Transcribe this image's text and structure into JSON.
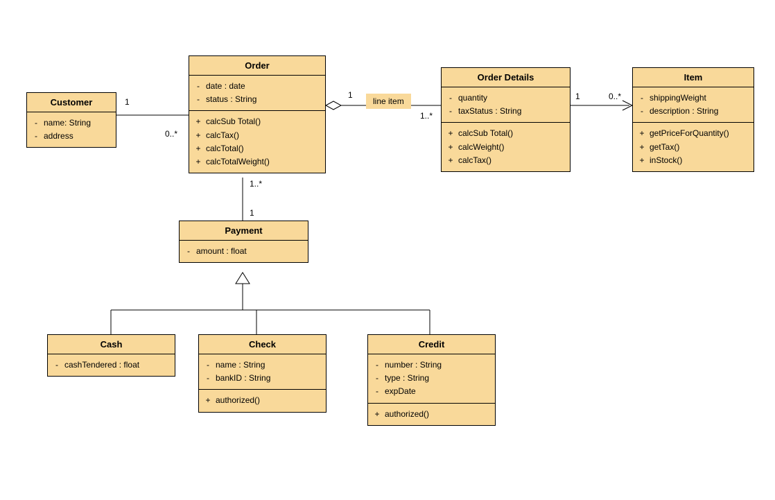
{
  "classes": {
    "customer": {
      "name": "Customer",
      "attrs": [
        {
          "vis": "-",
          "txt": "name: String"
        },
        {
          "vis": "-",
          "txt": "address"
        }
      ]
    },
    "order": {
      "name": "Order",
      "attrs": [
        {
          "vis": "-",
          "txt": "date : date"
        },
        {
          "vis": "-",
          "txt": "status : String"
        }
      ],
      "ops": [
        {
          "vis": "+",
          "txt": "calcSub Total()"
        },
        {
          "vis": "+",
          "txt": "calcTax()"
        },
        {
          "vis": "+",
          "txt": "calcTotal()"
        },
        {
          "vis": "+",
          "txt": "calcTotalWeight()"
        }
      ]
    },
    "orderDetails": {
      "name": "Order Details",
      "attrs": [
        {
          "vis": "-",
          "txt": "quantity"
        },
        {
          "vis": "-",
          "txt": "taxStatus : String"
        }
      ],
      "ops": [
        {
          "vis": "+",
          "txt": "calcSub Total()"
        },
        {
          "vis": "+",
          "txt": "calcWeight()"
        },
        {
          "vis": "+",
          "txt": "calcTax()"
        }
      ]
    },
    "item": {
      "name": "Item",
      "attrs": [
        {
          "vis": "-",
          "txt": "shippingWeight"
        },
        {
          "vis": "-",
          "txt": "description : String"
        }
      ],
      "ops": [
        {
          "vis": "+",
          "txt": "getPriceForQuantity()"
        },
        {
          "vis": "+",
          "txt": "getTax()"
        },
        {
          "vis": "+",
          "txt": "inStock()"
        }
      ]
    },
    "payment": {
      "name": "Payment",
      "attrs": [
        {
          "vis": "-",
          "txt": "amount : float"
        }
      ]
    },
    "cash": {
      "name": "Cash",
      "attrs": [
        {
          "vis": "-",
          "txt": "cashTendered : float"
        }
      ]
    },
    "check": {
      "name": "Check",
      "attrs": [
        {
          "vis": "-",
          "txt": "name : String"
        },
        {
          "vis": "-",
          "txt": "bankID : String"
        }
      ],
      "ops": [
        {
          "vis": "+",
          "txt": "authorized()"
        }
      ]
    },
    "credit": {
      "name": "Credit",
      "attrs": [
        {
          "vis": "-",
          "txt": "number : String"
        },
        {
          "vis": "-",
          "txt": "type : String"
        },
        {
          "vis": "-",
          "txt": "expDate"
        }
      ],
      "ops": [
        {
          "vis": "+",
          "txt": "authorized()"
        }
      ]
    }
  },
  "labels": {
    "lineItem": "line item"
  },
  "mult": {
    "cust1": "1",
    "order0star": "0..*",
    "order1aggr": "1",
    "od1star": "1..*",
    "od1": "1",
    "item0star": "0..*",
    "orderpay1star": "1..*",
    "payment1": "1"
  }
}
